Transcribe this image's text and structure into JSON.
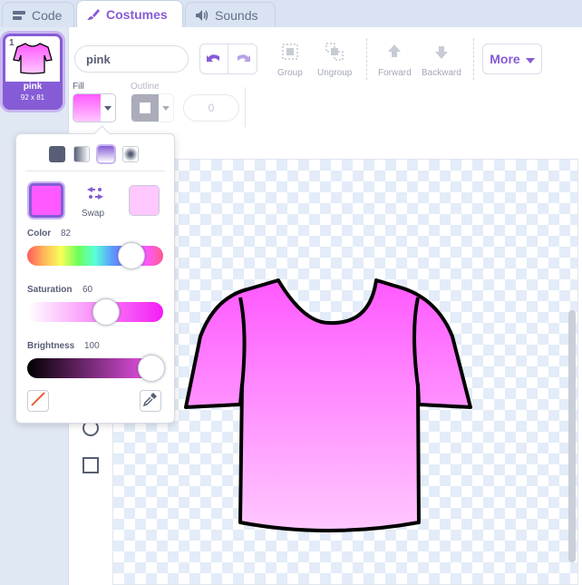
{
  "tabs": [
    {
      "label": "Code",
      "icon": "code-icon"
    },
    {
      "label": "Costumes",
      "icon": "brush-icon",
      "active": true
    },
    {
      "label": "Sounds",
      "icon": "speaker-icon"
    }
  ],
  "costume": {
    "number": "1",
    "name": "pink",
    "size": "92 x 81"
  },
  "toolbar": {
    "costume_name_value": "pink",
    "group_label": "Group",
    "ungroup_label": "Ungroup",
    "forward_label": "Forward",
    "backward_label": "Backward",
    "more_label": "More"
  },
  "fill": {
    "label": "Fill",
    "color_top": "#ff59ff",
    "color_bottom": "#ffc8ff"
  },
  "outline": {
    "label": "Outline",
    "width_placeholder": "0"
  },
  "picker": {
    "swap_label": "Swap",
    "primary_color": "#ff59ff",
    "secondary_color": "#ffc8ff",
    "color_label": "Color",
    "color_value": "82",
    "saturation_label": "Saturation",
    "saturation_value": "60",
    "brightness_label": "Brightness",
    "brightness_value": "100"
  },
  "colors": {
    "accent": "#855cd6",
    "shirt_outline": "#000000"
  }
}
